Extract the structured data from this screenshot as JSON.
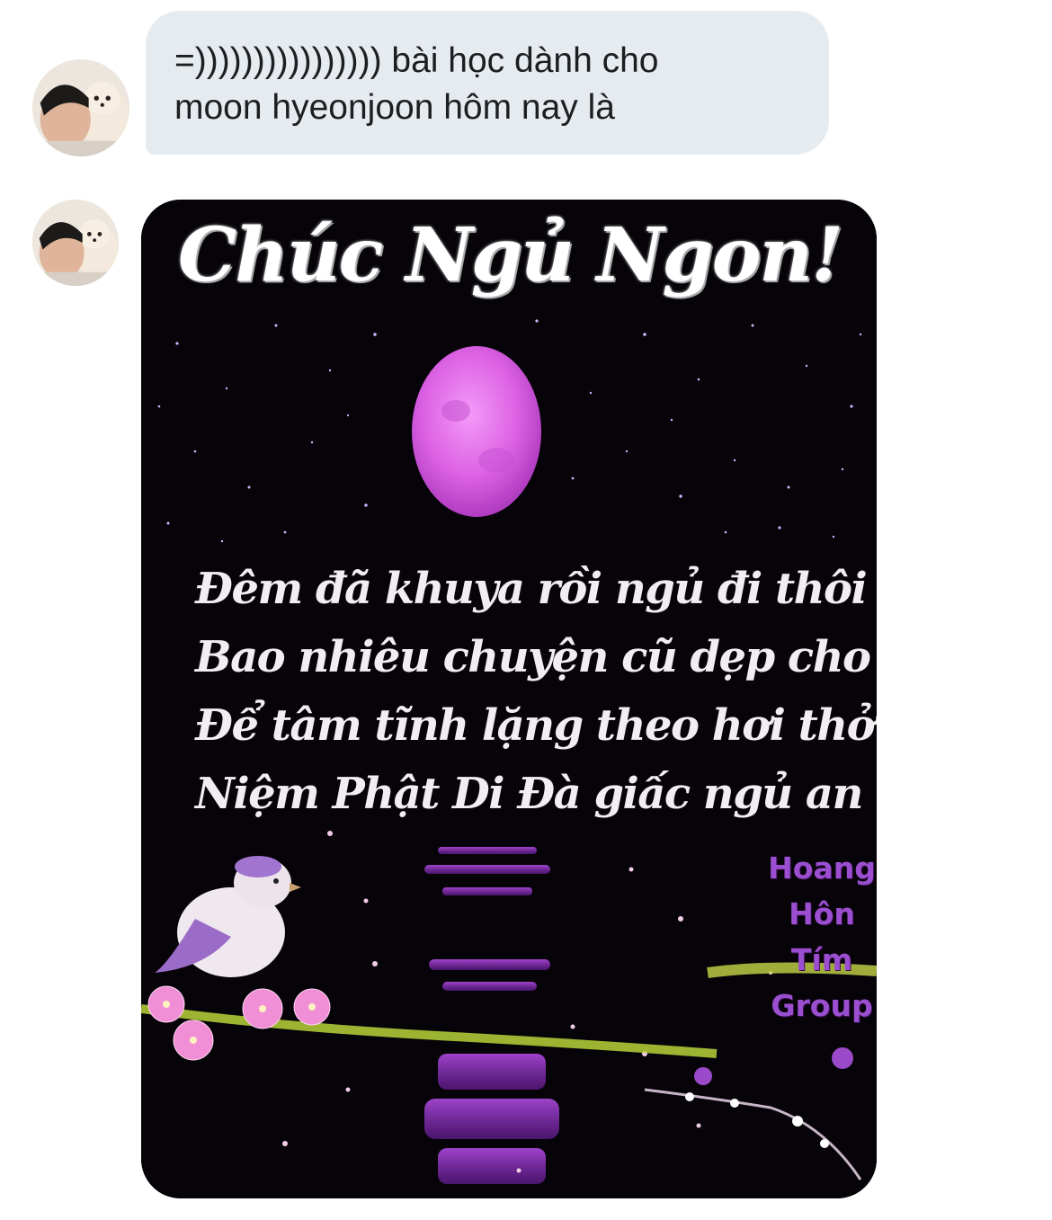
{
  "conversation": {
    "messages": [
      {
        "type": "text",
        "avatar_icon": "profile-photo",
        "text": "=)))))))))))))))) bài học dành cho\nmoon hyeonjoon hôm nay là"
      },
      {
        "type": "image",
        "avatar_icon": "profile-photo",
        "image": {
          "title": "Chúc Ngủ Ngon!",
          "poem": [
            "Đêm đã khuya rồi ngủ đi thôi",
            "Bao nhiêu chuyện cũ dẹp cho rồi",
            "Để tâm tĩnh lặng theo hơi thở",
            "Niệm Phật Di Đà giấc ngủ an"
          ],
          "watermark": [
            "Hoang",
            "Hôn",
            "Tím",
            "Group"
          ]
        }
      }
    ]
  },
  "colors": {
    "bubble_bg": "#e6ebf0",
    "text": "#1c1e21",
    "moon": "#e070e8",
    "watermark": "#9b4fd0"
  }
}
